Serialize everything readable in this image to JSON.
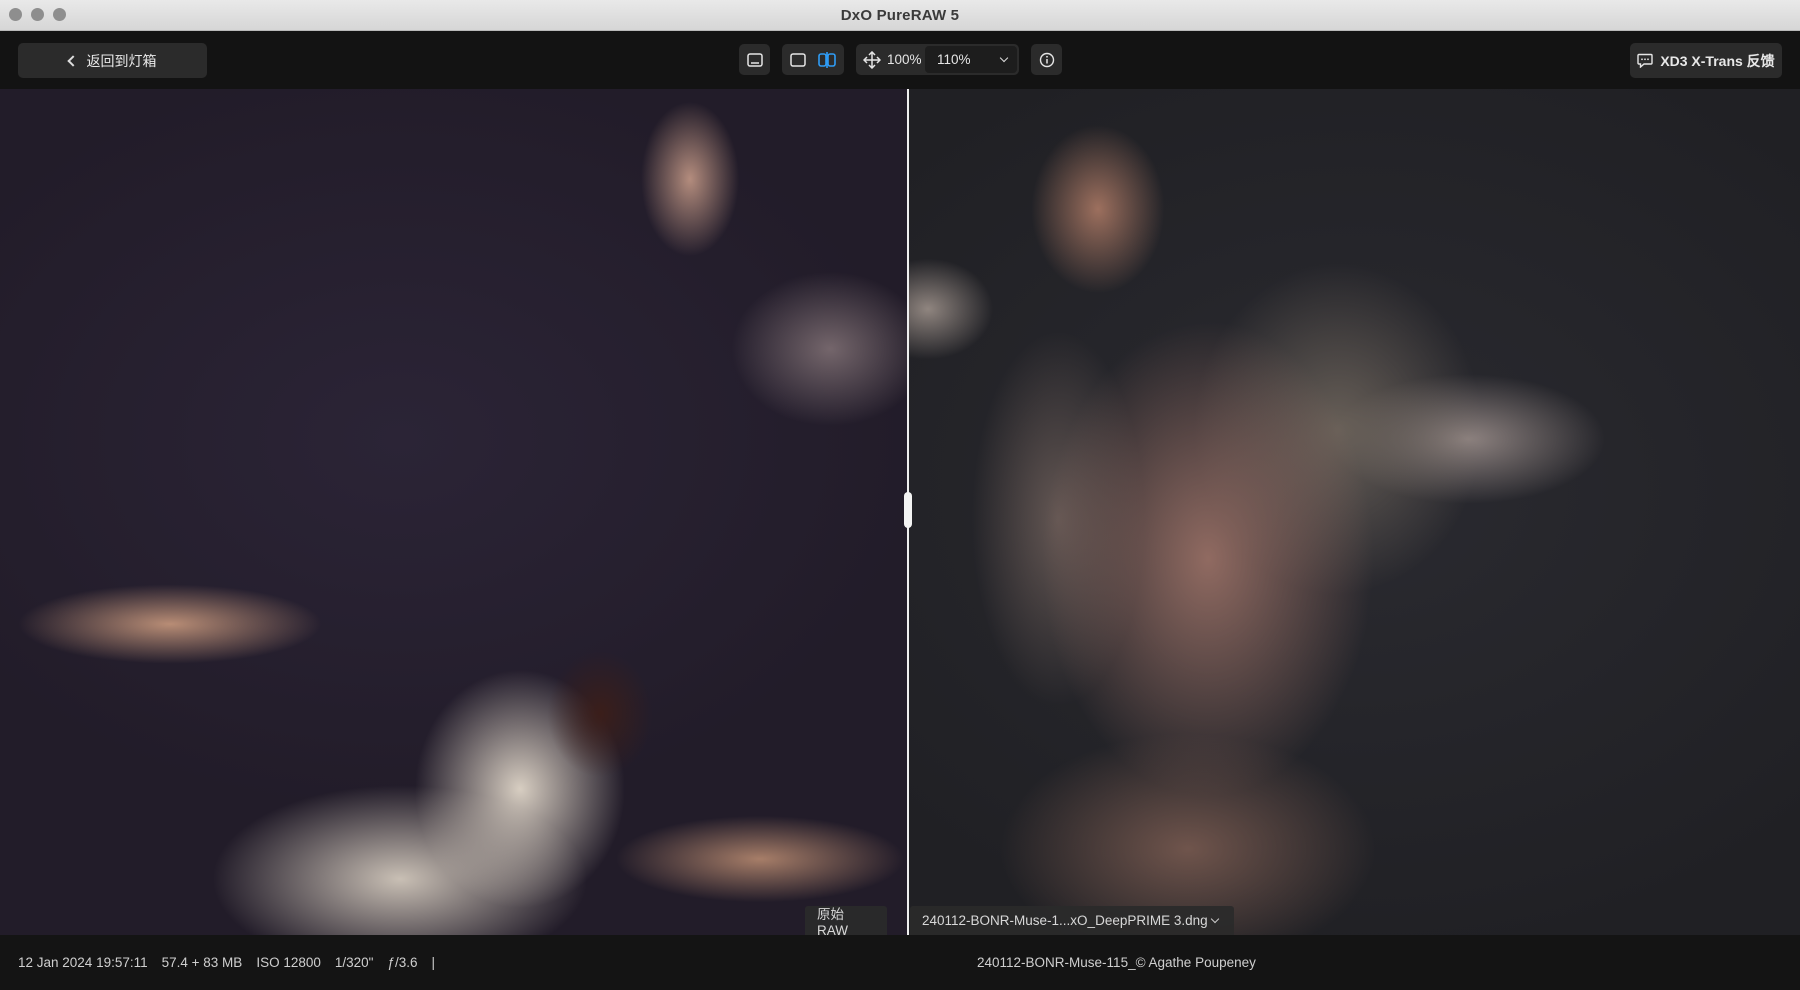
{
  "window": {
    "title": "DxO PureRAW 5"
  },
  "toolbar": {
    "back_label": "返回到灯箱",
    "icons": [
      "single-view-icon",
      "side-by-side-view-icon",
      "split-view-icon",
      "pan-move-icon",
      "info-icon",
      "chat-bubble-icon"
    ],
    "zoom_fit_label": "100%",
    "zoom_select_value": "110%",
    "feedback_label": "XD3 X-Trans 反馈",
    "accent_color": "#2f9cf5"
  },
  "viewer": {
    "left_label": "原始 RAW",
    "right_label": "240112-BONR-Muse-1...xO_DeepPRIME 3.dng"
  },
  "status": {
    "date": "12 Jan 2024 19:57:11",
    "size": "57.4 + 83 MB",
    "iso": "ISO 12800",
    "shutter": "1/320\"",
    "aperture": "ƒ/3.6",
    "separator": "|",
    "caption": "240112-BONR-Muse-115_© Agathe Poupeney"
  }
}
